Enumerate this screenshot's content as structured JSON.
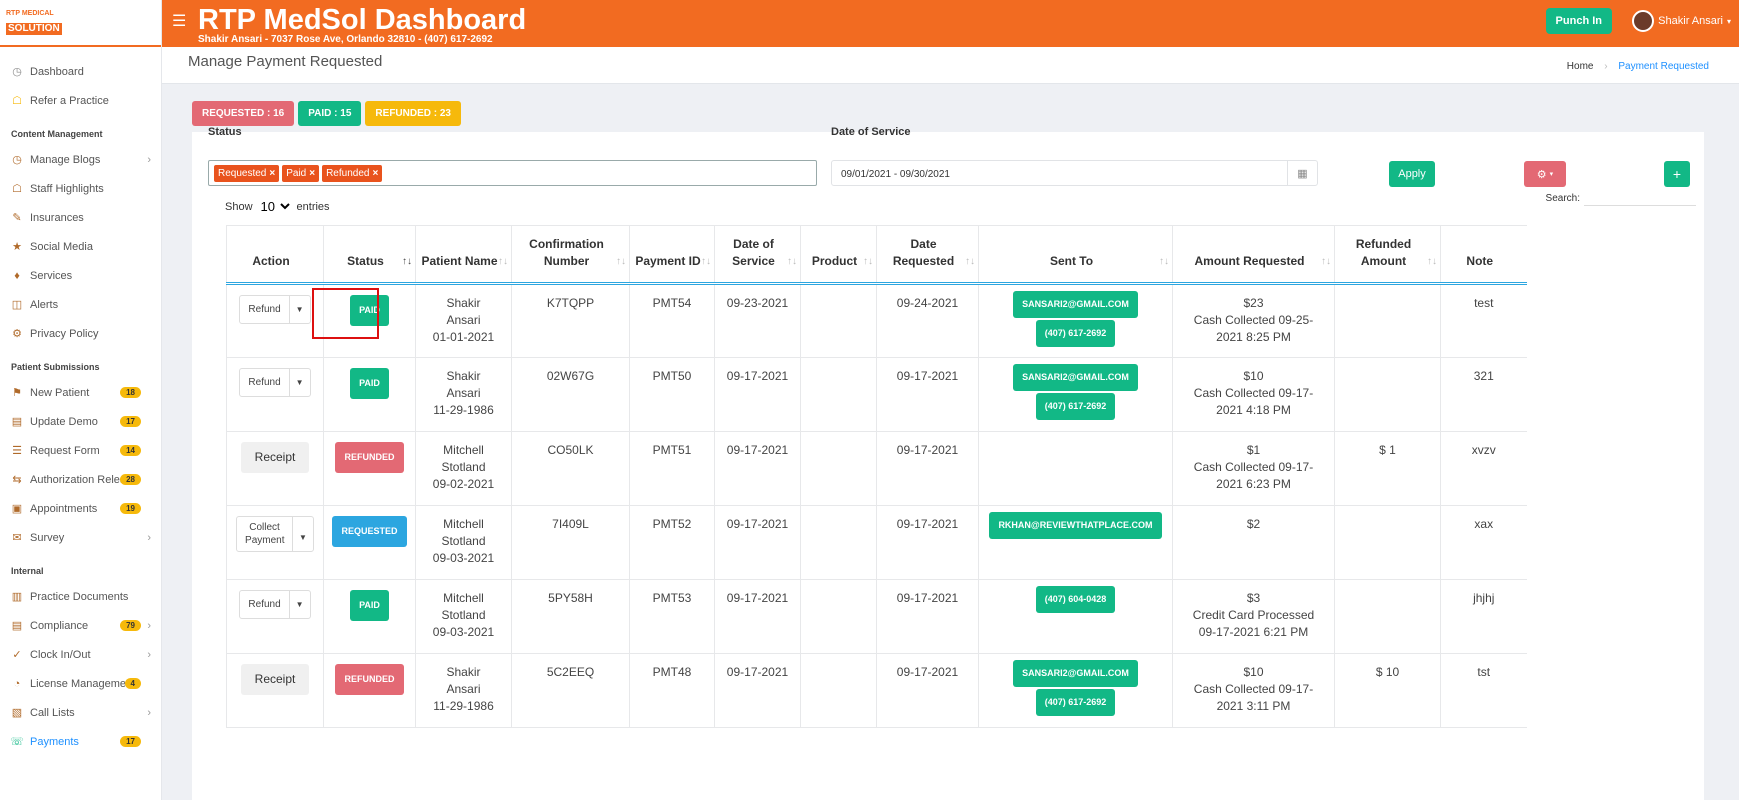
{
  "sidebar": {
    "logo_top": "RTP MEDICAL",
    "logo_bottom": "SOLUTION",
    "top_items": [
      {
        "label": "Dashboard",
        "icon": "gauge-icon"
      },
      {
        "label": "Refer a Practice",
        "icon": "handshake-icon"
      }
    ],
    "sections": [
      {
        "title": "Content Management",
        "items": [
          {
            "label": "Manage Blogs",
            "chevron": true
          },
          {
            "label": "Staff Highlights"
          },
          {
            "label": "Insurances"
          },
          {
            "label": "Social Media"
          },
          {
            "label": "Services"
          },
          {
            "label": "Alerts"
          },
          {
            "label": "Privacy Policy"
          }
        ]
      },
      {
        "title": "Patient Submissions",
        "items": [
          {
            "label": "New Patient",
            "count": "18"
          },
          {
            "label": "Update Demo",
            "count": "17"
          },
          {
            "label": "Request Form",
            "count": "14"
          },
          {
            "label": "Authorization Release",
            "count": "28"
          },
          {
            "label": "Appointments",
            "count": "19"
          },
          {
            "label": "Survey",
            "chevron": true
          }
        ]
      },
      {
        "title": "Internal",
        "items": [
          {
            "label": "Practice Documents"
          },
          {
            "label": "Compliance",
            "count": "79",
            "chevron": true
          },
          {
            "label": "Clock In/Out",
            "chevron": true
          },
          {
            "label": "License Management",
            "count": "4"
          },
          {
            "label": "Call Lists",
            "chevron": true
          },
          {
            "label": "Payments",
            "count": "17",
            "active": true
          }
        ]
      }
    ]
  },
  "header": {
    "title": "RTP MedSol Dashboard",
    "subtitle": "Shakir Ansari - 7037 Rose Ave, Orlando 32810 - (407) 617-2692",
    "punch_in": "Punch In",
    "user_name": "Shakir Ansari",
    "menu_icon": "hamburger-icon"
  },
  "page": {
    "title": "Manage Payment Requested",
    "breadcrumb_home": "Home",
    "breadcrumb_current": "Payment Requested"
  },
  "counters": {
    "requested": "REQUESTED : 16",
    "paid": "PAID : 15",
    "refunded": "REFUNDED : 23"
  },
  "filters": {
    "status_label": "Status",
    "status_chips": [
      "Requested",
      "Paid",
      "Refunded"
    ],
    "date_label": "Date of Service",
    "date_value": "09/01/2021 - 09/30/2021",
    "apply": "Apply",
    "plus": "+"
  },
  "table_controls": {
    "show": "Show",
    "entries_value": "10",
    "entries": "entries",
    "search": "Search:"
  },
  "columns": [
    {
      "label": "Action"
    },
    {
      "label": "Status"
    },
    {
      "label": "Patient Name"
    },
    {
      "label": "Confirmation Number"
    },
    {
      "label": "Payment ID"
    },
    {
      "label": "Date of Service"
    },
    {
      "label": "Product"
    },
    {
      "label": "Date Requested"
    },
    {
      "label": "Sent To"
    },
    {
      "label": "Amount Requested"
    },
    {
      "label": "Refunded Amount"
    },
    {
      "label": "Note"
    }
  ],
  "rows": [
    {
      "action": "Refund",
      "status": "PAID",
      "patient": [
        "Shakir",
        "Ansari",
        "01-01-2021"
      ],
      "confirmation": "K7TQPP",
      "payment_id": "PMT54",
      "dos": "09-23-2021",
      "product": "",
      "requested": "09-24-2021",
      "sent_to": [
        "SANSARI2@GMAIL.COM",
        "(407) 617-2692"
      ],
      "amount": [
        "$23",
        "Cash Collected 09-25-",
        "2021 8:25 PM"
      ],
      "refunded": "",
      "note": "test"
    },
    {
      "action": "Refund",
      "status": "PAID",
      "patient": [
        "Shakir",
        "Ansari",
        "11-29-1986"
      ],
      "confirmation": "02W67G",
      "payment_id": "PMT50",
      "dos": "09-17-2021",
      "product": "",
      "requested": "09-17-2021",
      "sent_to": [
        "SANSARI2@GMAIL.COM",
        "(407) 617-2692"
      ],
      "amount": [
        "$10",
        "Cash Collected 09-17-",
        "2021 4:18 PM"
      ],
      "refunded": "",
      "note": "321"
    },
    {
      "action": "Receipt",
      "status": "REFUNDED",
      "patient": [
        "Mitchell",
        "Stotland",
        "09-02-2021"
      ],
      "confirmation": "CO50LK",
      "payment_id": "PMT51",
      "dos": "09-17-2021",
      "product": "",
      "requested": "09-17-2021",
      "sent_to": [],
      "amount": [
        "$1",
        "Cash Collected 09-17-",
        "2021 6:23 PM"
      ],
      "refunded": "$ 1",
      "note": "xvzv"
    },
    {
      "action": "Collect Payment",
      "status": "REQUESTED",
      "patient": [
        "Mitchell",
        "Stotland",
        "09-03-2021"
      ],
      "confirmation": "7I409L",
      "payment_id": "PMT52",
      "dos": "09-17-2021",
      "product": "",
      "requested": "09-17-2021",
      "sent_to": [
        "RKHAN@REVIEWTHATPLACE.COM"
      ],
      "amount": [
        "$2"
      ],
      "refunded": "",
      "note": "xax"
    },
    {
      "action": "Refund",
      "status": "PAID",
      "patient": [
        "Mitchell",
        "Stotland",
        "09-03-2021"
      ],
      "confirmation": "5PY58H",
      "payment_id": "PMT53",
      "dos": "09-17-2021",
      "product": "",
      "requested": "09-17-2021",
      "sent_to": [
        "(407) 604-0428"
      ],
      "amount": [
        "$3",
        "Credit Card Processed",
        "09-17-2021 6:21 PM"
      ],
      "refunded": "",
      "note": "jhjhj"
    },
    {
      "action": "Receipt",
      "status": "REFUNDED",
      "patient": [
        "Shakir",
        "Ansari",
        "11-29-1986"
      ],
      "confirmation": "5C2EEQ",
      "payment_id": "PMT48",
      "dos": "09-17-2021",
      "product": "",
      "requested": "09-17-2021",
      "sent_to": [
        "SANSARI2@GMAIL.COM",
        "(407) 617-2692"
      ],
      "amount": [
        "$10",
        "Cash Collected 09-17-",
        "2021 3:11 PM"
      ],
      "refunded": "$ 10",
      "note": "tst"
    }
  ],
  "colors": {
    "brand": "#f26b21",
    "paid": "#12b886",
    "refunded": "#e36974",
    "requested": "#2ca6e0",
    "warning": "#f6b90b"
  }
}
